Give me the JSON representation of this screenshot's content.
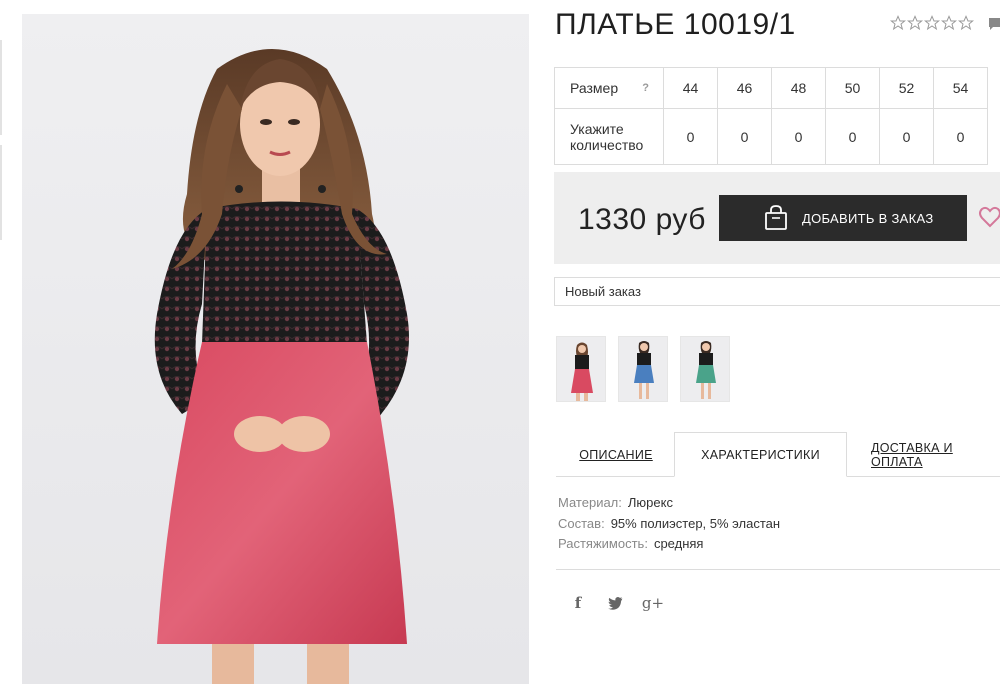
{
  "product": {
    "title": "ПЛАТЬЕ 10019/1",
    "rating_stars": 5,
    "rating_filled": 0
  },
  "sizes": {
    "size_label": "Размер",
    "help_mark": "?",
    "qty_label": "Укажите количество",
    "values": [
      "44",
      "46",
      "48",
      "50",
      "52",
      "54"
    ],
    "quantities": [
      "0",
      "0",
      "0",
      "0",
      "0",
      "0"
    ]
  },
  "purchase": {
    "price": "1330 руб",
    "add_button_label": "ДОБАВИТЬ В ЗАКАЗ",
    "order_select_value": "Новый заказ"
  },
  "thumbnails": [
    {
      "color": "pink"
    },
    {
      "color": "blue"
    },
    {
      "color": "green"
    }
  ],
  "tabs": {
    "description": "ОПИСАНИЕ",
    "characteristics": "ХАРАКТЕРИСТИКИ",
    "delivery": "ДОСТАВКА И ОПЛАТА"
  },
  "characteristics": [
    {
      "label": "Материал:",
      "value": "Люрекс"
    },
    {
      "label": "Состав:",
      "value": "95% полиэстер, 5% эластан"
    },
    {
      "label": "Растяжимость:",
      "value": "средняя"
    }
  ],
  "social": {
    "facebook": "f",
    "twitter": "twitter-icon",
    "googleplus": "g+"
  },
  "colors": {
    "button_bg": "#2b2b2b",
    "price_box_bg": "#eeeeee",
    "heart": "#d4789a",
    "dress_pink": "#d9485f",
    "lace_black": "#1a1a1a"
  }
}
